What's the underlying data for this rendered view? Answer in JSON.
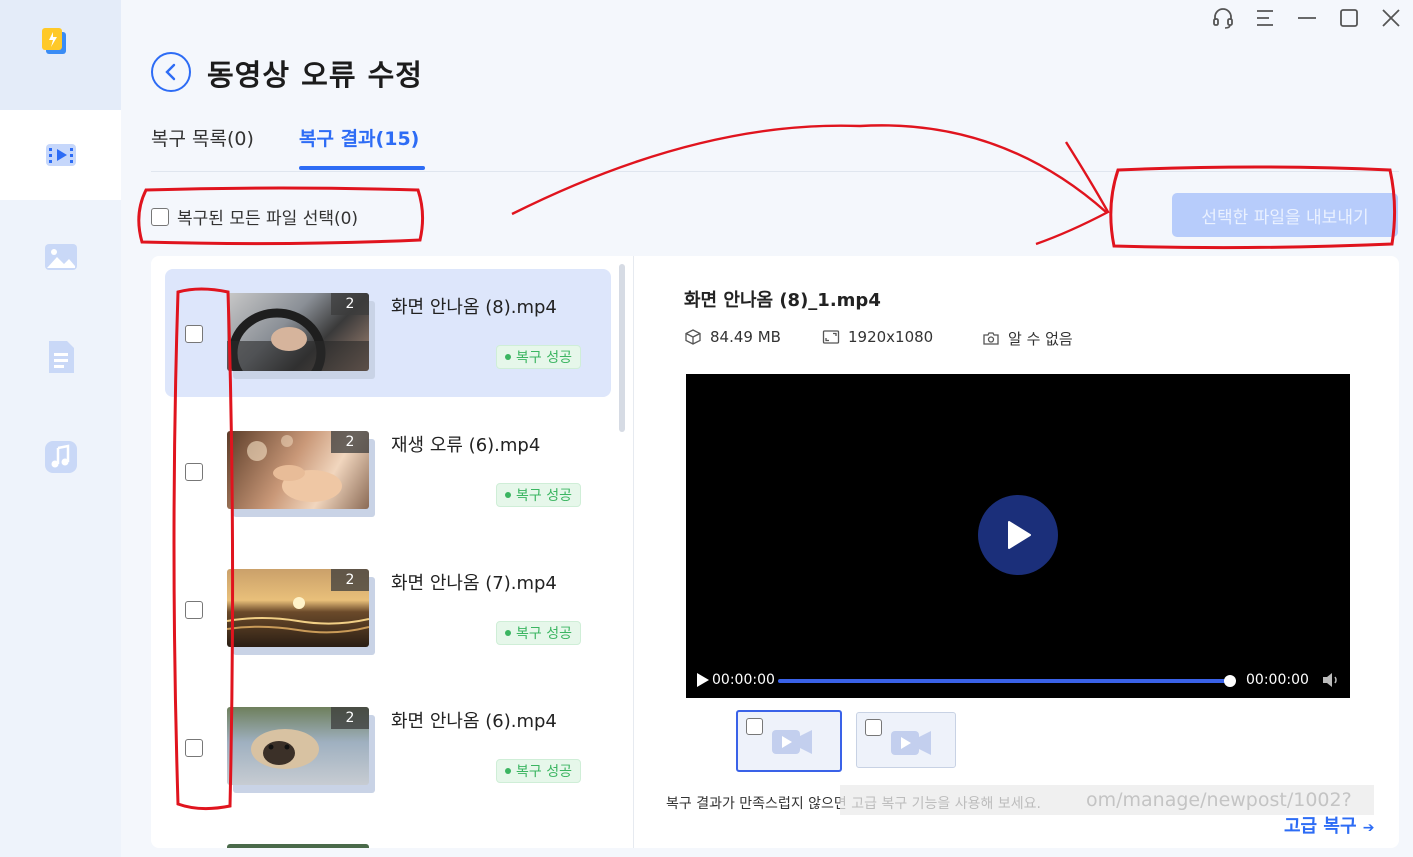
{
  "header": {
    "title": "동영상 오류 수정"
  },
  "tabs": [
    {
      "label": "복구 목록(0)"
    },
    {
      "label": "복구 결과(15)"
    }
  ],
  "toolbar": {
    "select_all_label": "복구된 모든 파일 선택(0)",
    "export_label": "선택한 파일을 내보내기"
  },
  "list": {
    "items": [
      {
        "name": "화면 안나옴 (8).mp4",
        "count": "2",
        "status": "복구 성공",
        "selected": true
      },
      {
        "name": "재생 오류 (6).mp4",
        "count": "2",
        "status": "복구 성공",
        "selected": false
      },
      {
        "name": "화면 안나옴 (7).mp4",
        "count": "2",
        "status": "복구 성공",
        "selected": false
      },
      {
        "name": "화면 안나옴 (6).mp4",
        "count": "2",
        "status": "복구 성공",
        "selected": false
      }
    ]
  },
  "preview": {
    "title": "화면 안나옴 (8)_1.mp4",
    "size": "84.49 MB",
    "resolution": "1920x1080",
    "camera": "알 수 없음",
    "time_current": "00:00:00",
    "time_total": "00:00:00",
    "hint": "복구 결과가 만족스럽지 않으면 고급 복구 기능을 사용해 보세요.",
    "watermark": "om/manage/newpost/1002?",
    "advanced_label": "고급 복구"
  },
  "colors": {
    "accent": "#2d6cf5",
    "success": "#3bb561",
    "annotation": "#e0141e"
  }
}
